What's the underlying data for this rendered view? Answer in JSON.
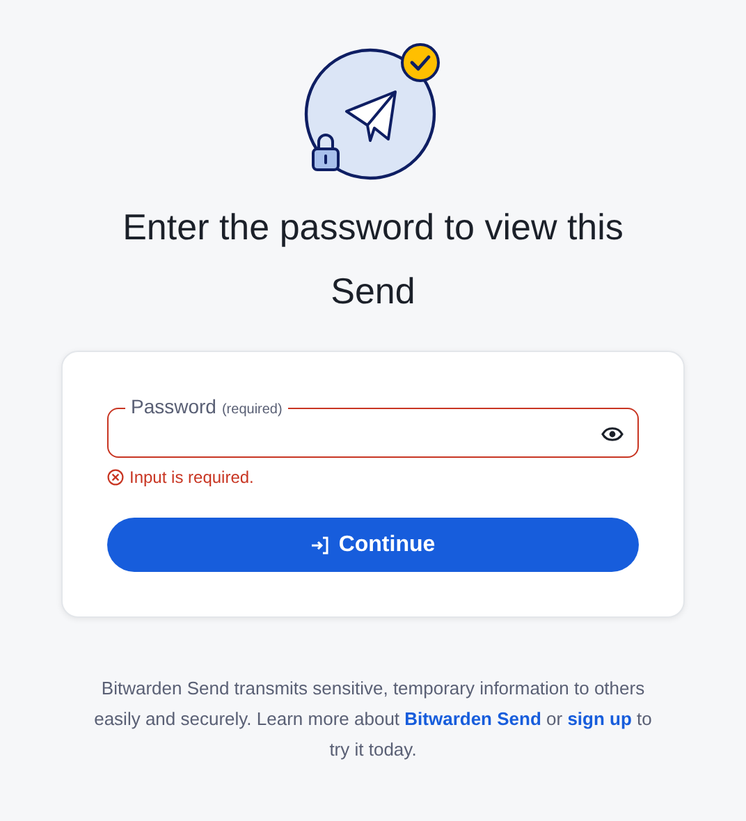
{
  "heading": "Enter the password to view this Send",
  "password_field": {
    "label": "Password",
    "hint": "(required)",
    "invalid": true,
    "error": "Input is required."
  },
  "continue_button": {
    "label": "Continue"
  },
  "footer": {
    "text_before": "Bitwarden Send transmits sensitive, temporary information to others easily and securely. Learn more about ",
    "link_1": "Bitwarden Send",
    "text_middle": " or ",
    "link_2": "sign up",
    "text_after": " to try it today."
  }
}
